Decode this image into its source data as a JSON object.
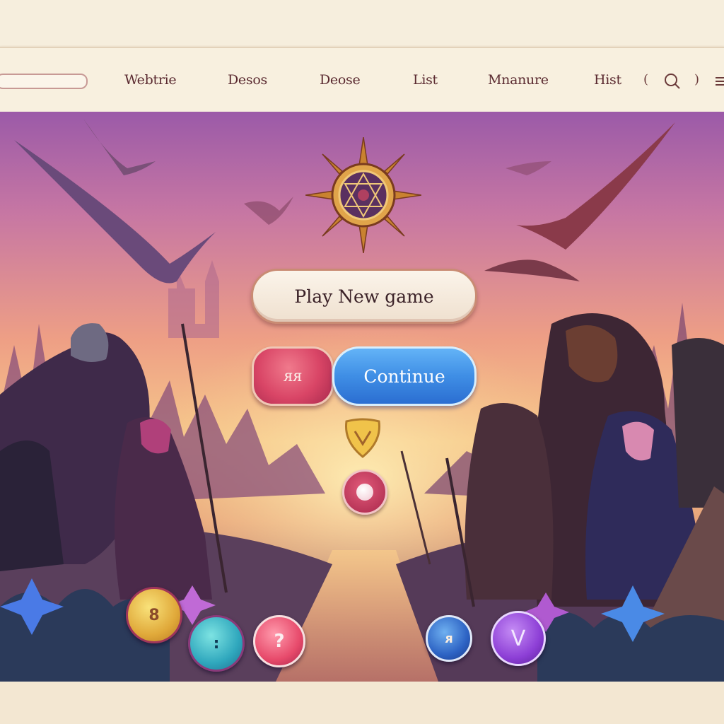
{
  "nav": {
    "items": [
      {
        "label": "Webtrie"
      },
      {
        "label": "Desos"
      },
      {
        "label": "Deose"
      },
      {
        "label": "List"
      },
      {
        "label": "Mnanure"
      },
      {
        "label": "Hist"
      }
    ],
    "bracket_left": "(",
    "bracket_right": ")"
  },
  "menu": {
    "play_label": "Play New game",
    "small_label": "ᴙᴙ",
    "continue_label": "Continue"
  },
  "orbs": {
    "yellow_glyph": "8",
    "teal_glyph": ":",
    "pink_glyph": "?",
    "blue_glyph": "ᴙ",
    "purple_glyph": "V"
  },
  "colors": {
    "nav_text": "#5a2a30",
    "play_button": "#f3e6d6",
    "continue_button": "#3f8ee5",
    "small_button": "#d94566",
    "sky_top": "#9b5aa8",
    "sky_glow": "#f6c98b"
  },
  "icons": [
    "search-icon",
    "menu-icon",
    "compass-emblem-icon",
    "shield-badge-icon",
    "record-icon"
  ]
}
